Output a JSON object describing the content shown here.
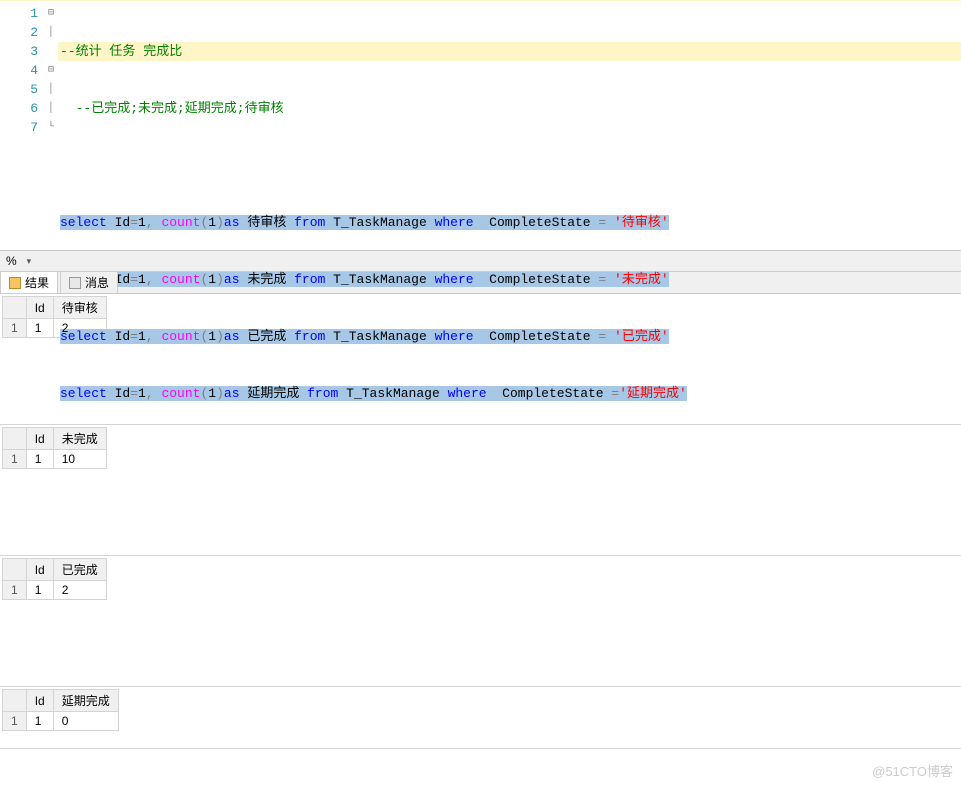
{
  "editor": {
    "line_numbers": [
      "1",
      "2",
      "3",
      "4",
      "5",
      "6",
      "7"
    ],
    "fold": [
      "⊟",
      "│",
      "",
      "⊟",
      "│",
      "│",
      "└"
    ],
    "comment1": "--统计 任务 完成比",
    "comment2": "  --已完成;未完成;延期完成;待审核",
    "sql": [
      {
        "kw1": "select",
        "id": " Id",
        "eq": "=",
        "num": "1",
        "comma": ", ",
        "fn": "count",
        "paren": "(",
        "one": "1",
        "paren2": ")",
        "as": "as ",
        "alias": "待审核 ",
        "from": "from ",
        "tbl": "T_TaskManage ",
        "where": "where ",
        "col": " CompleteState ",
        "eq2": "= ",
        "str": "'待审核'"
      },
      {
        "kw1": "select",
        "id": " Id",
        "eq": "=",
        "num": "1",
        "comma": ", ",
        "fn": "count",
        "paren": "(",
        "one": "1",
        "paren2": ")",
        "as": "as ",
        "alias": "未完成 ",
        "from": "from ",
        "tbl": "T_TaskManage ",
        "where": "where ",
        "col": " CompleteState ",
        "eq2": "= ",
        "str": "'未完成'"
      },
      {
        "kw1": "select",
        "id": " Id",
        "eq": "=",
        "num": "1",
        "comma": ", ",
        "fn": "count",
        "paren": "(",
        "one": "1",
        "paren2": ")",
        "as": "as ",
        "alias": "已完成 ",
        "from": "from ",
        "tbl": "T_TaskManage ",
        "where": "where ",
        "col": " CompleteState ",
        "eq2": "= ",
        "str": "'已完成'"
      },
      {
        "kw1": "select",
        "id": " Id",
        "eq": "=",
        "num": "1",
        "comma": ", ",
        "fn": "count",
        "paren": "(",
        "one": "1",
        "paren2": ")",
        "as": "as ",
        "alias": "延期完成 ",
        "from": "from ",
        "tbl": "T_TaskManage ",
        "where": "where ",
        "col": " CompleteState ",
        "eq2": "=",
        "str": "'延期完成'"
      }
    ]
  },
  "splitter": {
    "percent": "%",
    "arrow": "▾"
  },
  "tabs": {
    "results": "结果",
    "messages": "消息"
  },
  "results": [
    {
      "headers": [
        "Id",
        "待审核"
      ],
      "row": [
        "1",
        "2"
      ],
      "rownum": "1"
    },
    {
      "headers": [
        "Id",
        "未完成"
      ],
      "row": [
        "1",
        "10"
      ],
      "rownum": "1"
    },
    {
      "headers": [
        "Id",
        "已完成"
      ],
      "row": [
        "1",
        "2"
      ],
      "rownum": "1"
    },
    {
      "headers": [
        "Id",
        "延期完成"
      ],
      "row": [
        "1",
        "0"
      ],
      "rownum": "1"
    }
  ],
  "watermark": "@51CTO博客"
}
